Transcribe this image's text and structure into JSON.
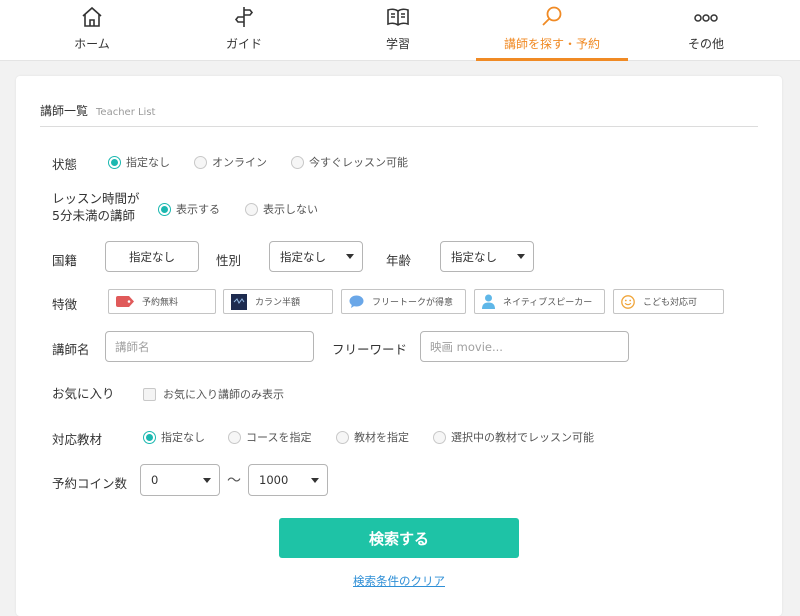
{
  "nav": {
    "items": [
      {
        "label": "ホーム",
        "icon": "home-icon"
      },
      {
        "label": "ガイド",
        "icon": "signpost-icon"
      },
      {
        "label": "学習",
        "icon": "book-icon"
      },
      {
        "label": "講師を探す・予約",
        "icon": "search-icon",
        "active": true
      },
      {
        "label": "その他",
        "icon": "more-dots-icon"
      }
    ],
    "accent": "#f08a24"
  },
  "header": {
    "title": "講師一覧",
    "subtitle": "Teacher List"
  },
  "status": {
    "label": "状態",
    "options": [
      "指定なし",
      "オンライン",
      "今すぐレッスン可能"
    ],
    "selected": 0
  },
  "short_lesson": {
    "label_line1": "レッスン時間が",
    "label_line2": "5分未満の講師",
    "options": [
      "表示する",
      "表示しない"
    ],
    "selected": 0
  },
  "nationality": {
    "label": "国籍",
    "value": "指定なし"
  },
  "gender": {
    "label": "性別",
    "value": "指定なし"
  },
  "age": {
    "label": "年齢",
    "value": "指定なし"
  },
  "features": {
    "label": "特徴",
    "tags": [
      {
        "label": "予約無料",
        "icon": "ticket-icon"
      },
      {
        "label": "カラン半額",
        "icon": "callan-icon"
      },
      {
        "label": "フリートークが得意",
        "icon": "speech-bubble-icon"
      },
      {
        "label": "ネイティブスピーカー",
        "icon": "person-icon"
      },
      {
        "label": "こども対応可",
        "icon": "smiley-icon"
      }
    ]
  },
  "teacher_name": {
    "label": "講師名",
    "placeholder": "講師名"
  },
  "free_word": {
    "label": "フリーワード",
    "placeholder": "映画 movie..."
  },
  "favorite": {
    "label": "お気に入り",
    "checkbox_label": "お気に入り講師のみ表示"
  },
  "material": {
    "label": "対応教材",
    "options": [
      "指定なし",
      "コースを指定",
      "教材を指定",
      "選択中の教材でレッスン可能"
    ],
    "selected": 0
  },
  "coins": {
    "label": "予約コイン数",
    "min": "0",
    "max": "1000",
    "separator": "〜"
  },
  "search_button": "検索する",
  "clear_link": "検索条件のクリア",
  "colors": {
    "accent": "#f08a24",
    "radio": "#1bb8b0",
    "button": "#1ec3a6",
    "link": "#2f8fd6"
  }
}
